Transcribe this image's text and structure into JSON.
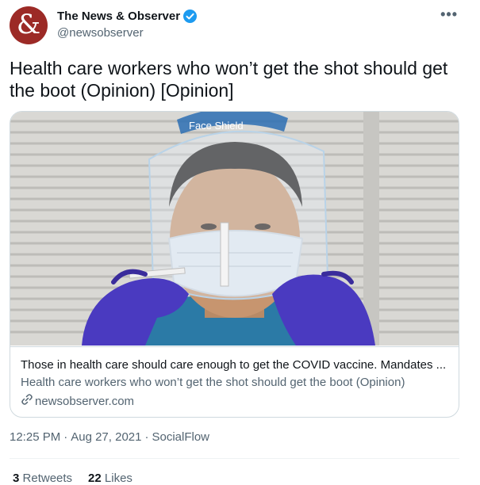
{
  "author": {
    "name": "The News & Observer",
    "handle": "@newsobserver",
    "avatar_glyph": "&",
    "avatar_color": "#9c2a26",
    "verified": true
  },
  "more_menu_label": "•••",
  "tweet": {
    "text": "Health care workers who won’t get the shot should get the boot (Opinion) [Opinion]"
  },
  "card": {
    "image_text": "Face Shield",
    "title": "Those in health care should care enough to get the COVID vaccine. Mandates ...",
    "description": "Health care workers who won’t get the shot should get the boot (Opinion)",
    "domain": "newsobserver.com"
  },
  "meta": {
    "time": "12:25 PM",
    "separator": "·",
    "date": "Aug 27, 2021",
    "source": "SocialFlow"
  },
  "stats": {
    "retweets_count": "3",
    "retweets_label": "Retweets",
    "likes_count": "22",
    "likes_label": "Likes"
  },
  "colors": {
    "accent": "#1d9bf0",
    "text": "#0f1419",
    "secondary": "#536471",
    "border": "#cfd9de"
  }
}
